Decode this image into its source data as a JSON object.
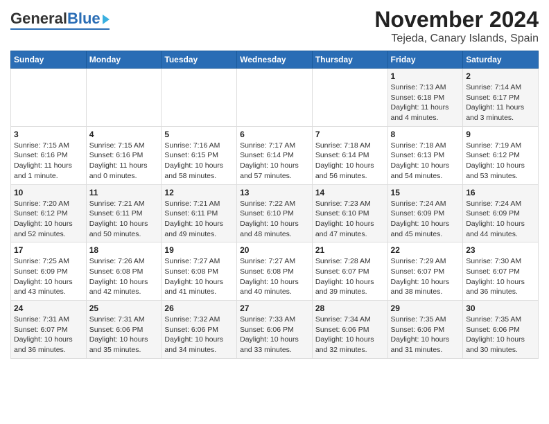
{
  "logo": {
    "text_general": "General",
    "text_blue": "Blue"
  },
  "title": "November 2024",
  "subtitle": "Tejeda, Canary Islands, Spain",
  "weekdays": [
    "Sunday",
    "Monday",
    "Tuesday",
    "Wednesday",
    "Thursday",
    "Friday",
    "Saturday"
  ],
  "weeks": [
    [
      {
        "day": "",
        "info": ""
      },
      {
        "day": "",
        "info": ""
      },
      {
        "day": "",
        "info": ""
      },
      {
        "day": "",
        "info": ""
      },
      {
        "day": "",
        "info": ""
      },
      {
        "day": "1",
        "info": "Sunrise: 7:13 AM\nSunset: 6:18 PM\nDaylight: 11 hours and 4 minutes."
      },
      {
        "day": "2",
        "info": "Sunrise: 7:14 AM\nSunset: 6:17 PM\nDaylight: 11 hours and 3 minutes."
      }
    ],
    [
      {
        "day": "3",
        "info": "Sunrise: 7:15 AM\nSunset: 6:16 PM\nDaylight: 11 hours and 1 minute."
      },
      {
        "day": "4",
        "info": "Sunrise: 7:15 AM\nSunset: 6:16 PM\nDaylight: 11 hours and 0 minutes."
      },
      {
        "day": "5",
        "info": "Sunrise: 7:16 AM\nSunset: 6:15 PM\nDaylight: 10 hours and 58 minutes."
      },
      {
        "day": "6",
        "info": "Sunrise: 7:17 AM\nSunset: 6:14 PM\nDaylight: 10 hours and 57 minutes."
      },
      {
        "day": "7",
        "info": "Sunrise: 7:18 AM\nSunset: 6:14 PM\nDaylight: 10 hours and 56 minutes."
      },
      {
        "day": "8",
        "info": "Sunrise: 7:18 AM\nSunset: 6:13 PM\nDaylight: 10 hours and 54 minutes."
      },
      {
        "day": "9",
        "info": "Sunrise: 7:19 AM\nSunset: 6:12 PM\nDaylight: 10 hours and 53 minutes."
      }
    ],
    [
      {
        "day": "10",
        "info": "Sunrise: 7:20 AM\nSunset: 6:12 PM\nDaylight: 10 hours and 52 minutes."
      },
      {
        "day": "11",
        "info": "Sunrise: 7:21 AM\nSunset: 6:11 PM\nDaylight: 10 hours and 50 minutes."
      },
      {
        "day": "12",
        "info": "Sunrise: 7:21 AM\nSunset: 6:11 PM\nDaylight: 10 hours and 49 minutes."
      },
      {
        "day": "13",
        "info": "Sunrise: 7:22 AM\nSunset: 6:10 PM\nDaylight: 10 hours and 48 minutes."
      },
      {
        "day": "14",
        "info": "Sunrise: 7:23 AM\nSunset: 6:10 PM\nDaylight: 10 hours and 47 minutes."
      },
      {
        "day": "15",
        "info": "Sunrise: 7:24 AM\nSunset: 6:09 PM\nDaylight: 10 hours and 45 minutes."
      },
      {
        "day": "16",
        "info": "Sunrise: 7:24 AM\nSunset: 6:09 PM\nDaylight: 10 hours and 44 minutes."
      }
    ],
    [
      {
        "day": "17",
        "info": "Sunrise: 7:25 AM\nSunset: 6:09 PM\nDaylight: 10 hours and 43 minutes."
      },
      {
        "day": "18",
        "info": "Sunrise: 7:26 AM\nSunset: 6:08 PM\nDaylight: 10 hours and 42 minutes."
      },
      {
        "day": "19",
        "info": "Sunrise: 7:27 AM\nSunset: 6:08 PM\nDaylight: 10 hours and 41 minutes."
      },
      {
        "day": "20",
        "info": "Sunrise: 7:27 AM\nSunset: 6:08 PM\nDaylight: 10 hours and 40 minutes."
      },
      {
        "day": "21",
        "info": "Sunrise: 7:28 AM\nSunset: 6:07 PM\nDaylight: 10 hours and 39 minutes."
      },
      {
        "day": "22",
        "info": "Sunrise: 7:29 AM\nSunset: 6:07 PM\nDaylight: 10 hours and 38 minutes."
      },
      {
        "day": "23",
        "info": "Sunrise: 7:30 AM\nSunset: 6:07 PM\nDaylight: 10 hours and 36 minutes."
      }
    ],
    [
      {
        "day": "24",
        "info": "Sunrise: 7:31 AM\nSunset: 6:07 PM\nDaylight: 10 hours and 36 minutes."
      },
      {
        "day": "25",
        "info": "Sunrise: 7:31 AM\nSunset: 6:06 PM\nDaylight: 10 hours and 35 minutes."
      },
      {
        "day": "26",
        "info": "Sunrise: 7:32 AM\nSunset: 6:06 PM\nDaylight: 10 hours and 34 minutes."
      },
      {
        "day": "27",
        "info": "Sunrise: 7:33 AM\nSunset: 6:06 PM\nDaylight: 10 hours and 33 minutes."
      },
      {
        "day": "28",
        "info": "Sunrise: 7:34 AM\nSunset: 6:06 PM\nDaylight: 10 hours and 32 minutes."
      },
      {
        "day": "29",
        "info": "Sunrise: 7:35 AM\nSunset: 6:06 PM\nDaylight: 10 hours and 31 minutes."
      },
      {
        "day": "30",
        "info": "Sunrise: 7:35 AM\nSunset: 6:06 PM\nDaylight: 10 hours and 30 minutes."
      }
    ]
  ]
}
